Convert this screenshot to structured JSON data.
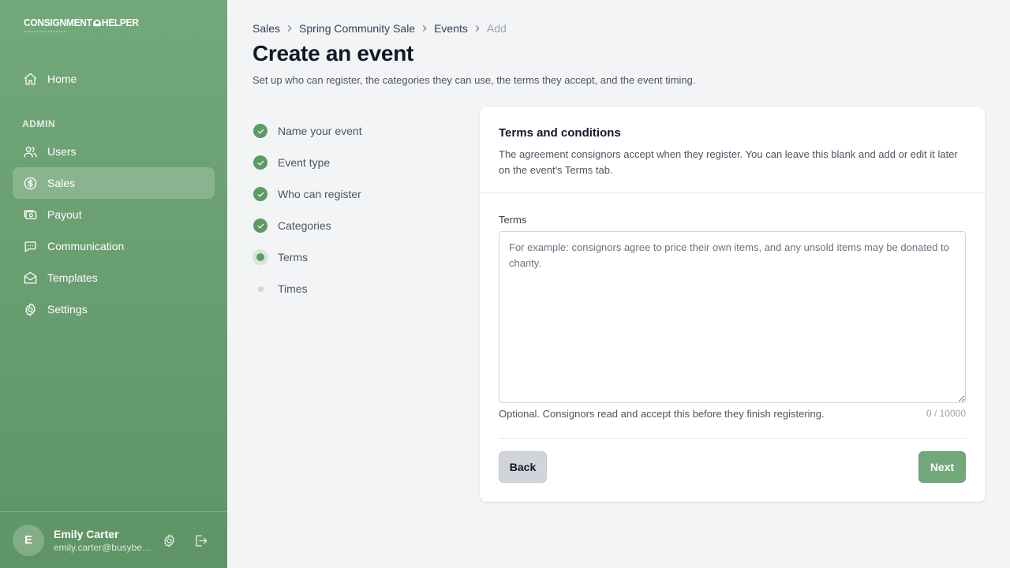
{
  "app": {
    "logo_left": "CONSIGNMENT",
    "logo_right": "HELPER"
  },
  "sidebar": {
    "section_label": "ADMIN",
    "items": [
      {
        "label": "Home",
        "icon": "home-icon"
      },
      {
        "label": "Users",
        "icon": "users-icon"
      },
      {
        "label": "Sales",
        "icon": "dollar-circle-icon",
        "active": true
      },
      {
        "label": "Payout",
        "icon": "cash-icon"
      },
      {
        "label": "Communication",
        "icon": "chat-icon"
      },
      {
        "label": "Templates",
        "icon": "envelope-icon"
      },
      {
        "label": "Settings",
        "icon": "gear-icon"
      }
    ],
    "user": {
      "initial": "E",
      "name": "Emily Carter",
      "email": "emily.carter@busybee.com"
    }
  },
  "breadcrumb": [
    "Sales",
    "Spring Community Sale",
    "Events",
    "Add"
  ],
  "page": {
    "title": "Create an event",
    "subtitle": "Set up who can register, the categories they can use, the terms they accept, and the event timing."
  },
  "steps": [
    {
      "label": "Name your event",
      "status": "complete"
    },
    {
      "label": "Event type",
      "status": "complete"
    },
    {
      "label": "Who can register",
      "status": "complete"
    },
    {
      "label": "Categories",
      "status": "complete"
    },
    {
      "label": "Terms",
      "status": "current"
    },
    {
      "label": "Times",
      "status": "upcoming"
    }
  ],
  "card": {
    "title": "Terms and conditions",
    "description": "The agreement consignors accept when they register. You can leave this blank and add or edit it later on the event's Terms tab.",
    "field_label": "Terms",
    "value": "",
    "placeholder": "For example: consignors agree to price their own items, and any unsold items may be donated to charity.",
    "help": "Optional. Consignors read and accept this before they finish registering.",
    "counter": "0 / 10000",
    "back_label": "Back",
    "next_label": "Next"
  },
  "colors": {
    "accent": "#73a87b",
    "step_complete": "#5d9a66",
    "sidebar_bottom": "#5f9466"
  }
}
